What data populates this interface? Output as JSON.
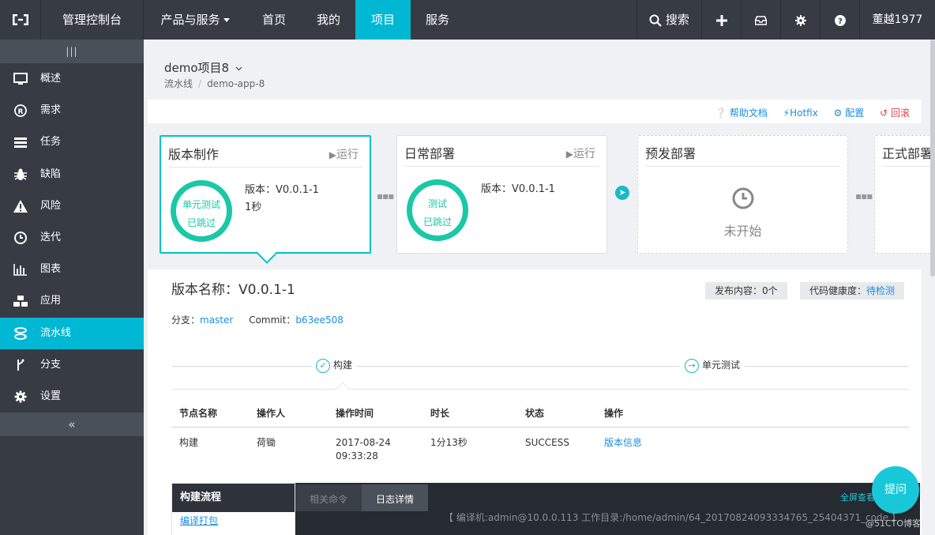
{
  "topbar": {
    "console": "管理控制台",
    "nav": [
      {
        "label": "产品与服务"
      },
      {
        "label": "首页"
      },
      {
        "label": "我的"
      },
      {
        "label": "项目",
        "active": true
      },
      {
        "label": "服务"
      }
    ],
    "search_label": "搜索",
    "user": "董越1977",
    "active_color": "#00b7d4"
  },
  "sidebar": {
    "toggle_icon": "|||",
    "items": [
      {
        "label": "概述",
        "icon": "monitor-icon"
      },
      {
        "label": "需求",
        "icon": "registered-icon"
      },
      {
        "label": "任务",
        "icon": "list-icon"
      },
      {
        "label": "缺陷",
        "icon": "bug-icon"
      },
      {
        "label": "风险",
        "icon": "warning-icon"
      },
      {
        "label": "迭代",
        "icon": "clock-icon"
      },
      {
        "label": "图表",
        "icon": "bar-chart-icon"
      },
      {
        "label": "应用",
        "icon": "cubes-icon"
      },
      {
        "label": "流水线",
        "icon": "pipeline-icon",
        "active": true
      },
      {
        "label": "分支",
        "icon": "branch-icon"
      },
      {
        "label": "设置",
        "icon": "gear-icon"
      }
    ],
    "collapse_icon": "«"
  },
  "project": {
    "title": "demo项目8",
    "breadcrumb": [
      "流水线",
      "demo-app-8"
    ]
  },
  "tool_links": {
    "help": "帮助文档",
    "hotfix": "Hotfix",
    "config": "配置",
    "rollback": "回滚"
  },
  "stages": [
    {
      "title": "版本制作",
      "run": "运行",
      "ring_top": "单元测试",
      "ring_bottom": "已跳过",
      "info1": "版本：V0.0.1-1",
      "info2": "1秒"
    },
    {
      "title": "日常部署",
      "run": "运行",
      "ring_top": "测试",
      "ring_bottom": "已跳过",
      "info1": "版本：V0.0.1-1"
    },
    {
      "title": "预发部署",
      "status": "未开始"
    },
    {
      "title": "正式部署"
    }
  ],
  "detail": {
    "version_label": "版本名称：V0.0.1-1",
    "publish_content": "发布内容：0个",
    "health_label": "代码健康度：",
    "health_value": "待检测",
    "branch_label": "分支：",
    "branch_value": "master",
    "commit_label": "Commit：",
    "commit_value": "b63ee508",
    "steps": [
      "构建",
      "单元测试"
    ]
  },
  "table": {
    "headers": [
      "节点名称",
      "操作人",
      "操作时间",
      "时长",
      "状态",
      "操作"
    ],
    "row": {
      "node": "构建",
      "operator": "荷锄",
      "time_date": "2017-08-24",
      "time_clock": "09:33:28",
      "duration": "1分13秒",
      "status": "SUCCESS",
      "action": "版本信息"
    }
  },
  "build": {
    "title": "构建流程",
    "item": "编译打包",
    "tabs": [
      "相关命令",
      "日志详情"
    ],
    "full_log": "全屏查看日志",
    "log_line": "【 编译机:admin@10.0.0.113    工作目录:/home/admin/64_20170824093334765_25404371_code 】"
  },
  "ask_button": "提问",
  "watermark": "@51CTO博客"
}
